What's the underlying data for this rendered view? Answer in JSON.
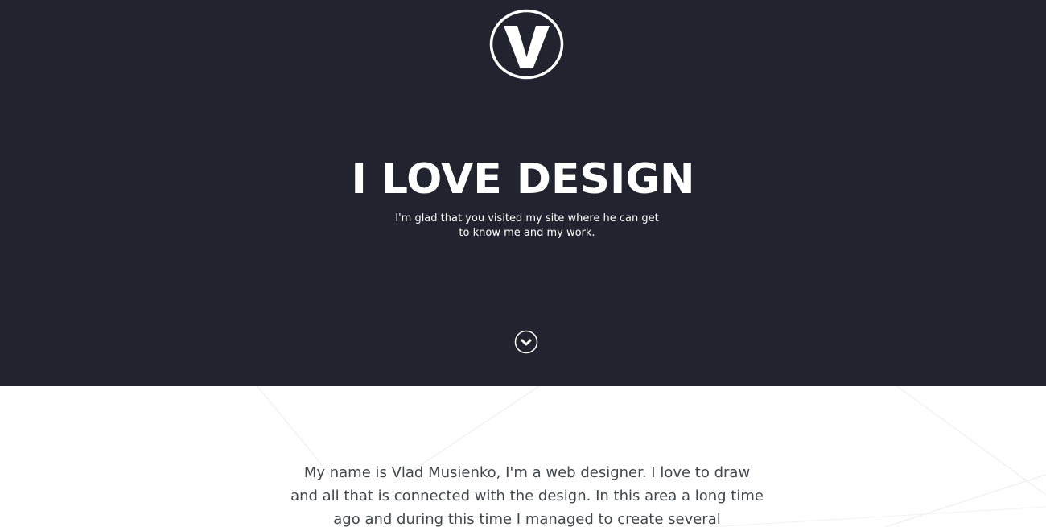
{
  "logo": {
    "letter": "V",
    "icon": "v-logo-icon"
  },
  "hero": {
    "title": "I LOVE DESIGN",
    "subtitle": "I'm glad that you visited my site where he can get to know me and my work.",
    "scroll_icon": "chevron-down-circle-icon"
  },
  "about": {
    "text": "My name is Vlad Musienko, I'm a web designer. I love to draw and all that is connected with the design. In this area a long time ago and during this time I managed to create several"
  },
  "colors": {
    "hero_bg": "#232330",
    "hero_text": "#ffffff",
    "body_bg": "#ffffff",
    "body_text": "#44464f"
  }
}
